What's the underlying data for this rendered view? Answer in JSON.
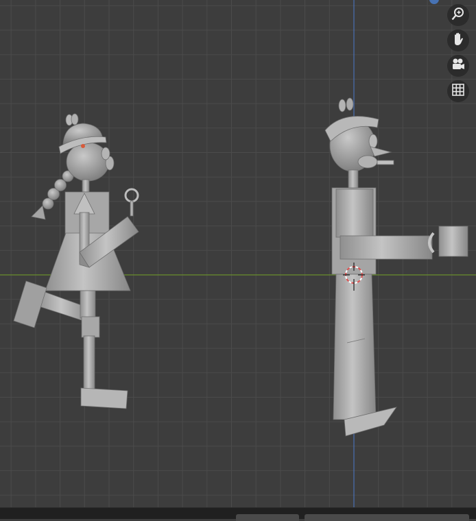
{
  "viewport": {
    "background_color": "#3d3d3d",
    "grid_color": "#4b4b4b",
    "x_axis_color": "#6a8f2c",
    "z_axis_color": "#4a70b5",
    "mesh_color": "#a9a9a9"
  },
  "navigation_gizmo": {
    "buttons": [
      {
        "icon": "zoom-icon",
        "tooltip": ""
      },
      {
        "icon": "hand-pan-icon",
        "tooltip": ""
      },
      {
        "icon": "camera-icon",
        "tooltip": ""
      },
      {
        "icon": "grid-icon",
        "tooltip": ""
      }
    ]
  },
  "status_bar": {
    "background_color": "#202020"
  }
}
